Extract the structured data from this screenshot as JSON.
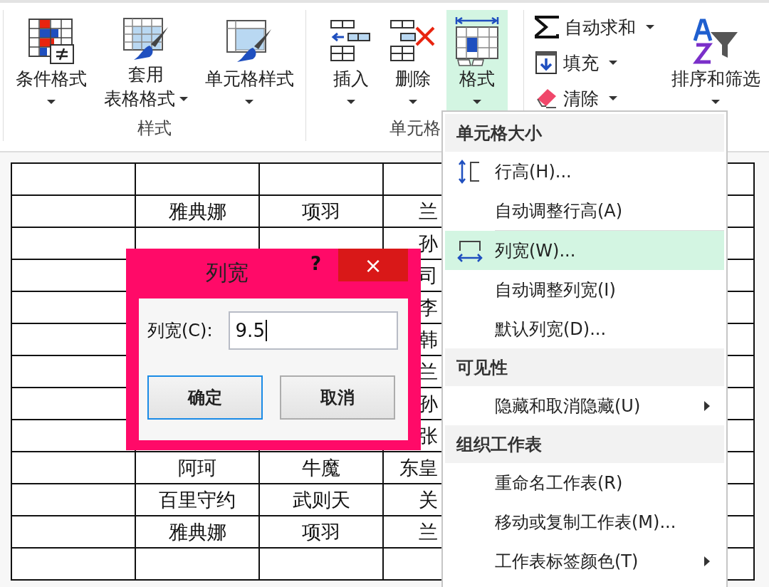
{
  "ribbon": {
    "groups": [
      {
        "label": "样式",
        "buttons": [
          {
            "kind": "conditional-format",
            "lines": [
              "条件格式"
            ],
            "dropdown": true,
            "selected": false
          },
          {
            "kind": "table-format",
            "lines": [
              "套用",
              "表格格式"
            ],
            "dropdown": true,
            "selected": false
          },
          {
            "kind": "cell-style",
            "lines": [
              "单元格样式"
            ],
            "dropdown": true,
            "selected": false
          }
        ]
      },
      {
        "label": "单元格",
        "buttons": [
          {
            "kind": "insert",
            "lines": [
              "插入"
            ],
            "dropdown": true,
            "selected": false
          },
          {
            "kind": "delete",
            "lines": [
              "删除"
            ],
            "dropdown": true,
            "selected": false
          },
          {
            "kind": "format",
            "lines": [
              "格式"
            ],
            "dropdown": true,
            "selected": true
          }
        ]
      },
      {
        "small_buttons": [
          {
            "kind": "autosum",
            "label": "自动求和",
            "dropdown": true
          },
          {
            "kind": "fill",
            "label": "填充",
            "dropdown": true
          },
          {
            "kind": "clear",
            "label": "清除",
            "dropdown": true
          }
        ],
        "buttons": [
          {
            "kind": "sort-filter",
            "lines": [
              "排序和筛选"
            ],
            "dropdown": true,
            "selected": false
          }
        ]
      }
    ]
  },
  "sheet": {
    "rows": [
      {},
      {
        "column_2": "雅典娜",
        "column_3": "项羽",
        "column_4": "兰"
      },
      {
        "column_4": "孙"
      },
      {
        "column_4": "司"
      },
      {
        "column_4": "李"
      },
      {
        "column_4": "韩"
      },
      {
        "column_4": "兰"
      },
      {
        "column_4": "孙"
      },
      {
        "column_4": "张"
      },
      {
        "column_2": "阿珂",
        "column_3": "牛魔",
        "column_4": "东皇"
      },
      {
        "column_2": "百里守约",
        "column_3": "武则天",
        "column_4": "关"
      },
      {
        "column_2": "雅典娜",
        "column_3": "项羽",
        "column_4": "兰"
      },
      {}
    ]
  },
  "dialog": {
    "title": "列宽",
    "help": "?",
    "close": "×",
    "field_label": "列宽(C):",
    "value": "9.5",
    "buttons": [
      {
        "label": "确定",
        "default": true
      },
      {
        "label": "取消",
        "default": false
      }
    ]
  },
  "menu": {
    "items": [
      {
        "kind": "header",
        "label": "单元格大小"
      },
      {
        "kind": "row-height-command",
        "label": "行高(H)...",
        "selected": false,
        "submenu": false
      },
      {
        "kind": "command",
        "label": "自动调整行高(A)",
        "selected": false,
        "submenu": false
      },
      {
        "kind": "column-width-command",
        "label": "列宽(W)...",
        "selected": true,
        "submenu": false
      },
      {
        "kind": "command",
        "label": "自动调整列宽(I)",
        "selected": false,
        "submenu": false
      },
      {
        "kind": "command",
        "label": "默认列宽(D)...",
        "selected": false,
        "submenu": false
      },
      {
        "kind": "header",
        "label": "可见性"
      },
      {
        "kind": "command",
        "label": "隐藏和取消隐藏(U)",
        "selected": false,
        "submenu": true
      },
      {
        "kind": "header",
        "label": "组织工作表"
      },
      {
        "kind": "command",
        "label": "重命名工作表(R)",
        "selected": false,
        "submenu": false
      },
      {
        "kind": "command",
        "label": "移动或复制工作表(M)...",
        "selected": false,
        "submenu": false
      },
      {
        "kind": "command",
        "label": "工作表标签颜色(T)",
        "selected": false,
        "submenu": true
      }
    ]
  }
}
